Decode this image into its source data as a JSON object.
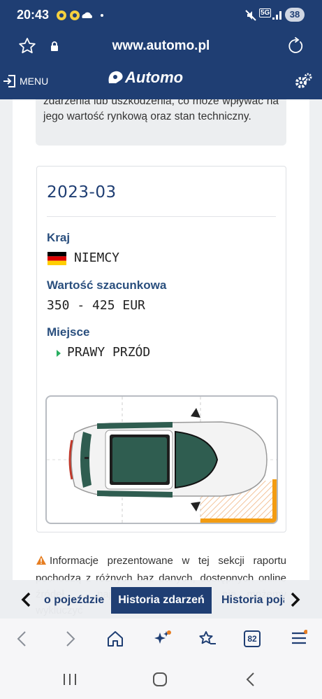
{
  "status": {
    "time": "20:43",
    "network": "5G",
    "battery": "38"
  },
  "browser": {
    "url": "www.automo.pl",
    "tab_count": "82"
  },
  "header": {
    "menu_label": "MENU",
    "logo_text": "Automo"
  },
  "intro_text": "zidentyfikowany jako posiadający odnotowane zdarzenia lub uszkodzenia, co może wpływać na jego wartość rynkową oraz stan techniczny.",
  "event": {
    "date": "2023-03",
    "country_label": "Kraj",
    "country_value": "NIEMCY",
    "value_label": "Wartość szacunkowa",
    "value_value": "350 - 425 EUR",
    "place_label": "Miejsce",
    "place_value": "PRAWY PRZÓD"
  },
  "info_text": "Informacje prezentowane w tej sekcji raportu pochodzą z różnych baz danych, dostępnych online źródeł, ... najbardziej precyzyjne, nie możemy wykluczyć",
  "tabs": {
    "prev": "o pojeździe",
    "active": "Historia zdarzeń",
    "next": "Historia poja"
  },
  "colors": {
    "brand": "#1f3e73",
    "accent": "#f39c12",
    "label": "#2a4f7e"
  }
}
